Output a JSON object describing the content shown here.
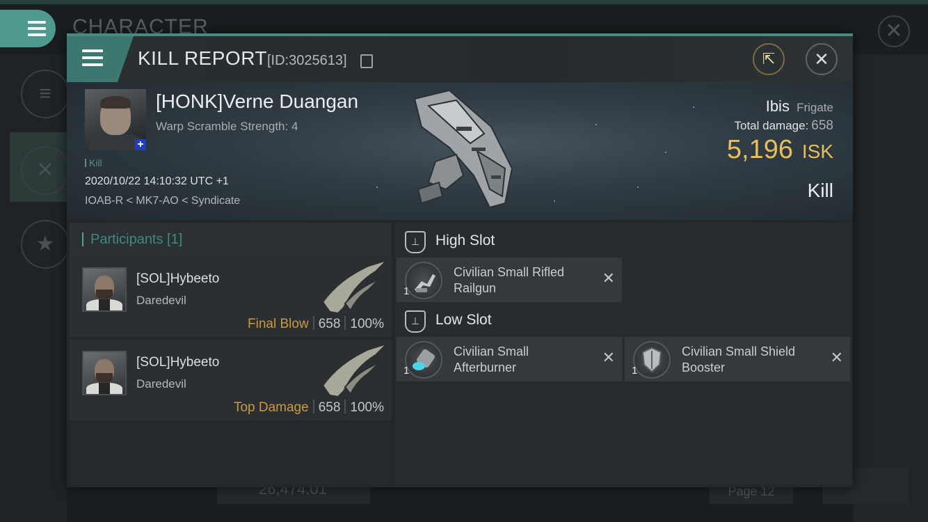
{
  "background": {
    "window_title": "CHARACTER",
    "balance": "26,474.01",
    "page": "Page 12",
    "close_glyph": "✕"
  },
  "header": {
    "title": "KILL REPORT",
    "id": "[ID:3025613]",
    "close_glyph": "✕",
    "share_glyph": "⇱"
  },
  "victim": {
    "name": "[HONK]Verne Duangan",
    "warp_scramble": "Warp Scramble Strength: 4",
    "tag": "Kill",
    "time": "2020/10/22 14:10:32 UTC +1",
    "location": "IOAB-R < MK7-AO < Syndicate"
  },
  "ship": {
    "name": "Ibis",
    "class": "Frigate",
    "total_damage_label": "Total damage:",
    "total_damage": "658",
    "isk_value": "5,196",
    "isk_unit": "ISK",
    "result": "Kill"
  },
  "participants": {
    "title": "Participants [1]",
    "rows": [
      {
        "name": "[SOL]Hybeeto",
        "ship": "Daredevil",
        "label": "Final Blow",
        "damage": "658",
        "percent": "100%"
      },
      {
        "name": "[SOL]Hybeeto",
        "ship": "Daredevil",
        "label": "Top Damage",
        "damage": "658",
        "percent": "100%"
      }
    ]
  },
  "fittings": {
    "high_slot": {
      "label": "High Slot",
      "modules": [
        {
          "qty": "1",
          "name": "Civilian Small Rifled Railgun",
          "remove": "✕"
        }
      ]
    },
    "low_slot": {
      "label": "Low Slot",
      "modules": [
        {
          "qty": "1",
          "name": "Civilian Small Afterburner",
          "remove": "✕"
        },
        {
          "qty": "1",
          "name": "Civilian Small Shield Booster",
          "remove": "✕"
        }
      ]
    }
  },
  "colors": {
    "accent": "#4e9a8f",
    "isk": "#e8bf5e",
    "final_blow": "#c99a3e",
    "victim_plus": "#1f3fb8"
  }
}
